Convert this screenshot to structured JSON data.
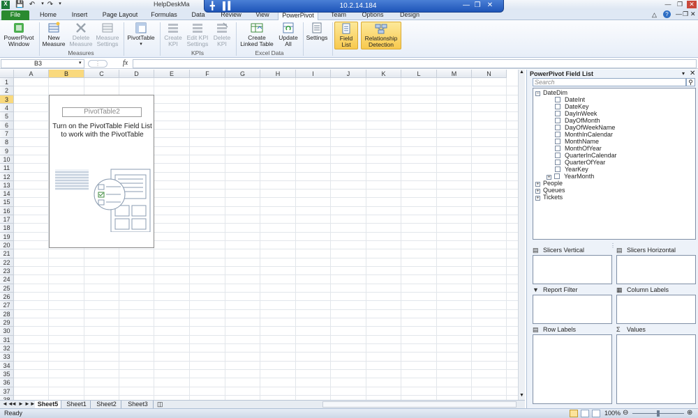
{
  "window": {
    "title": "HelpDeskMa",
    "remote_ip": "10.2.14.184"
  },
  "tabs": [
    "File",
    "Home",
    "Insert",
    "Page Layout",
    "Formulas",
    "Data",
    "Review",
    "View",
    "PowerPivot",
    "Team",
    "Options",
    "Design"
  ],
  "active_tab": "PowerPivot",
  "ribbon": {
    "powerpivot_window": "PowerPivot\nWindow",
    "new_measure": "New\nMeasure",
    "delete_measure": "Delete\nMeasure",
    "measure_settings": "Measure\nSettings",
    "group_measures": "Measures",
    "pivottable": "PivotTable",
    "create_kpi": "Create\nKPI",
    "edit_kpi": "Edit KPI\nSettings",
    "delete_kpi": "Delete\nKPI",
    "group_kpis": "KPIs",
    "create_linked_table": "Create\nLinked Table",
    "update_all": "Update\nAll",
    "group_excel_data": "Excel Data",
    "settings": "Settings",
    "field_list": "Field\nList",
    "relationship_detection": "Relationship\nDetection"
  },
  "formula_bar": {
    "name_box": "B3",
    "fx": "fx"
  },
  "columns": [
    "A",
    "B",
    "C",
    "D",
    "E",
    "F",
    "G",
    "H",
    "I",
    "J",
    "K",
    "L",
    "M",
    "N"
  ],
  "rows": [
    "1",
    "2",
    "3",
    "4",
    "5",
    "6",
    "7",
    "8",
    "9",
    "10",
    "11",
    "12",
    "13",
    "14",
    "15",
    "16",
    "17",
    "18",
    "19",
    "20",
    "21",
    "22",
    "23",
    "24",
    "25",
    "26",
    "27",
    "28",
    "29",
    "30",
    "31",
    "32",
    "33",
    "34",
    "35",
    "36",
    "37",
    "38"
  ],
  "pivot": {
    "name": "PivotTable2",
    "message": "Turn on the PivotTable Field List to work with the PivotTable"
  },
  "sheets": [
    "Sheet5",
    "Sheet1",
    "Sheet2",
    "Sheet3"
  ],
  "active_sheet": "Sheet5",
  "status": {
    "ready": "Ready",
    "zoom": "100%"
  },
  "field_list": {
    "title": "PowerPivot Field List",
    "search_placeholder": "Search",
    "tables": [
      {
        "name": "DateDim",
        "expanded": true,
        "fields": [
          "DateInt",
          "DateKey",
          "DayInWeek",
          "DayOfMonth",
          "DayOfWeekName",
          "MonthInCalendar",
          "MonthName",
          "MonthOfYear",
          "QuarterInCalendar",
          "QuarterOfYear",
          "YearKey",
          "YearMonth"
        ]
      },
      {
        "name": "People",
        "expanded": false
      },
      {
        "name": "Queues",
        "expanded": false
      },
      {
        "name": "Tickets",
        "expanded": false
      }
    ],
    "areas": {
      "slicers_vertical": "Slicers Vertical",
      "slicers_horizontal": "Slicers Horizontal",
      "report_filter": "Report Filter",
      "column_labels": "Column Labels",
      "row_labels": "Row Labels",
      "values": "Values"
    }
  }
}
